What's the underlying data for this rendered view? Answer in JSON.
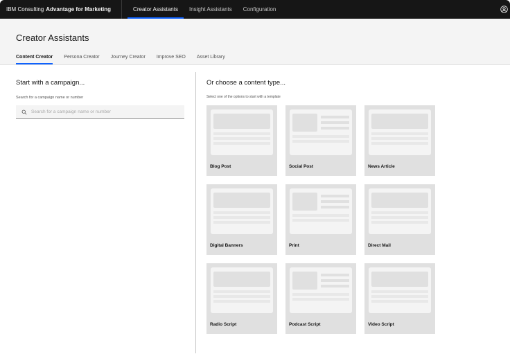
{
  "topbar": {
    "brand_prefix": "IBM Consulting",
    "brand_bold": "Advantage for Marketing",
    "nav": [
      {
        "label": "Creator Assistants",
        "active": true
      },
      {
        "label": "Insight Assistants",
        "active": false
      },
      {
        "label": "Configuration",
        "active": false
      }
    ],
    "user_icon": "user-avatar-icon"
  },
  "header": {
    "title": "Creator Assistants",
    "tabs": [
      {
        "label": "Content Creator",
        "active": true
      },
      {
        "label": "Persona Creator",
        "active": false
      },
      {
        "label": "Journey Creator",
        "active": false
      },
      {
        "label": "Improve SEO",
        "active": false
      },
      {
        "label": "Asset Library",
        "active": false
      }
    ]
  },
  "left": {
    "heading": "Start with a campaign...",
    "search_label": "Search for a campaign name or number",
    "search_placeholder": "Search for a campaign name or number",
    "search_icon": "search-icon"
  },
  "right": {
    "heading": "Or choose a content type...",
    "helper": "Select one of the options to start with a template",
    "cards": [
      {
        "label": "Blog Post",
        "layout": "A"
      },
      {
        "label": "Social Post",
        "layout": "B"
      },
      {
        "label": "News Article",
        "layout": "A"
      },
      {
        "label": "Digital Banners",
        "layout": "A"
      },
      {
        "label": "Print",
        "layout": "B"
      },
      {
        "label": "Direct Mail",
        "layout": "A"
      },
      {
        "label": "Radio Script",
        "layout": "A"
      },
      {
        "label": "Podcast Script",
        "layout": "B"
      },
      {
        "label": "Video Script",
        "layout": "A"
      }
    ]
  },
  "colors": {
    "topbar_bg": "#161616",
    "accent": "#0f62fe",
    "header_bg": "#f4f4f4",
    "card_bg": "#e0e0e0"
  }
}
